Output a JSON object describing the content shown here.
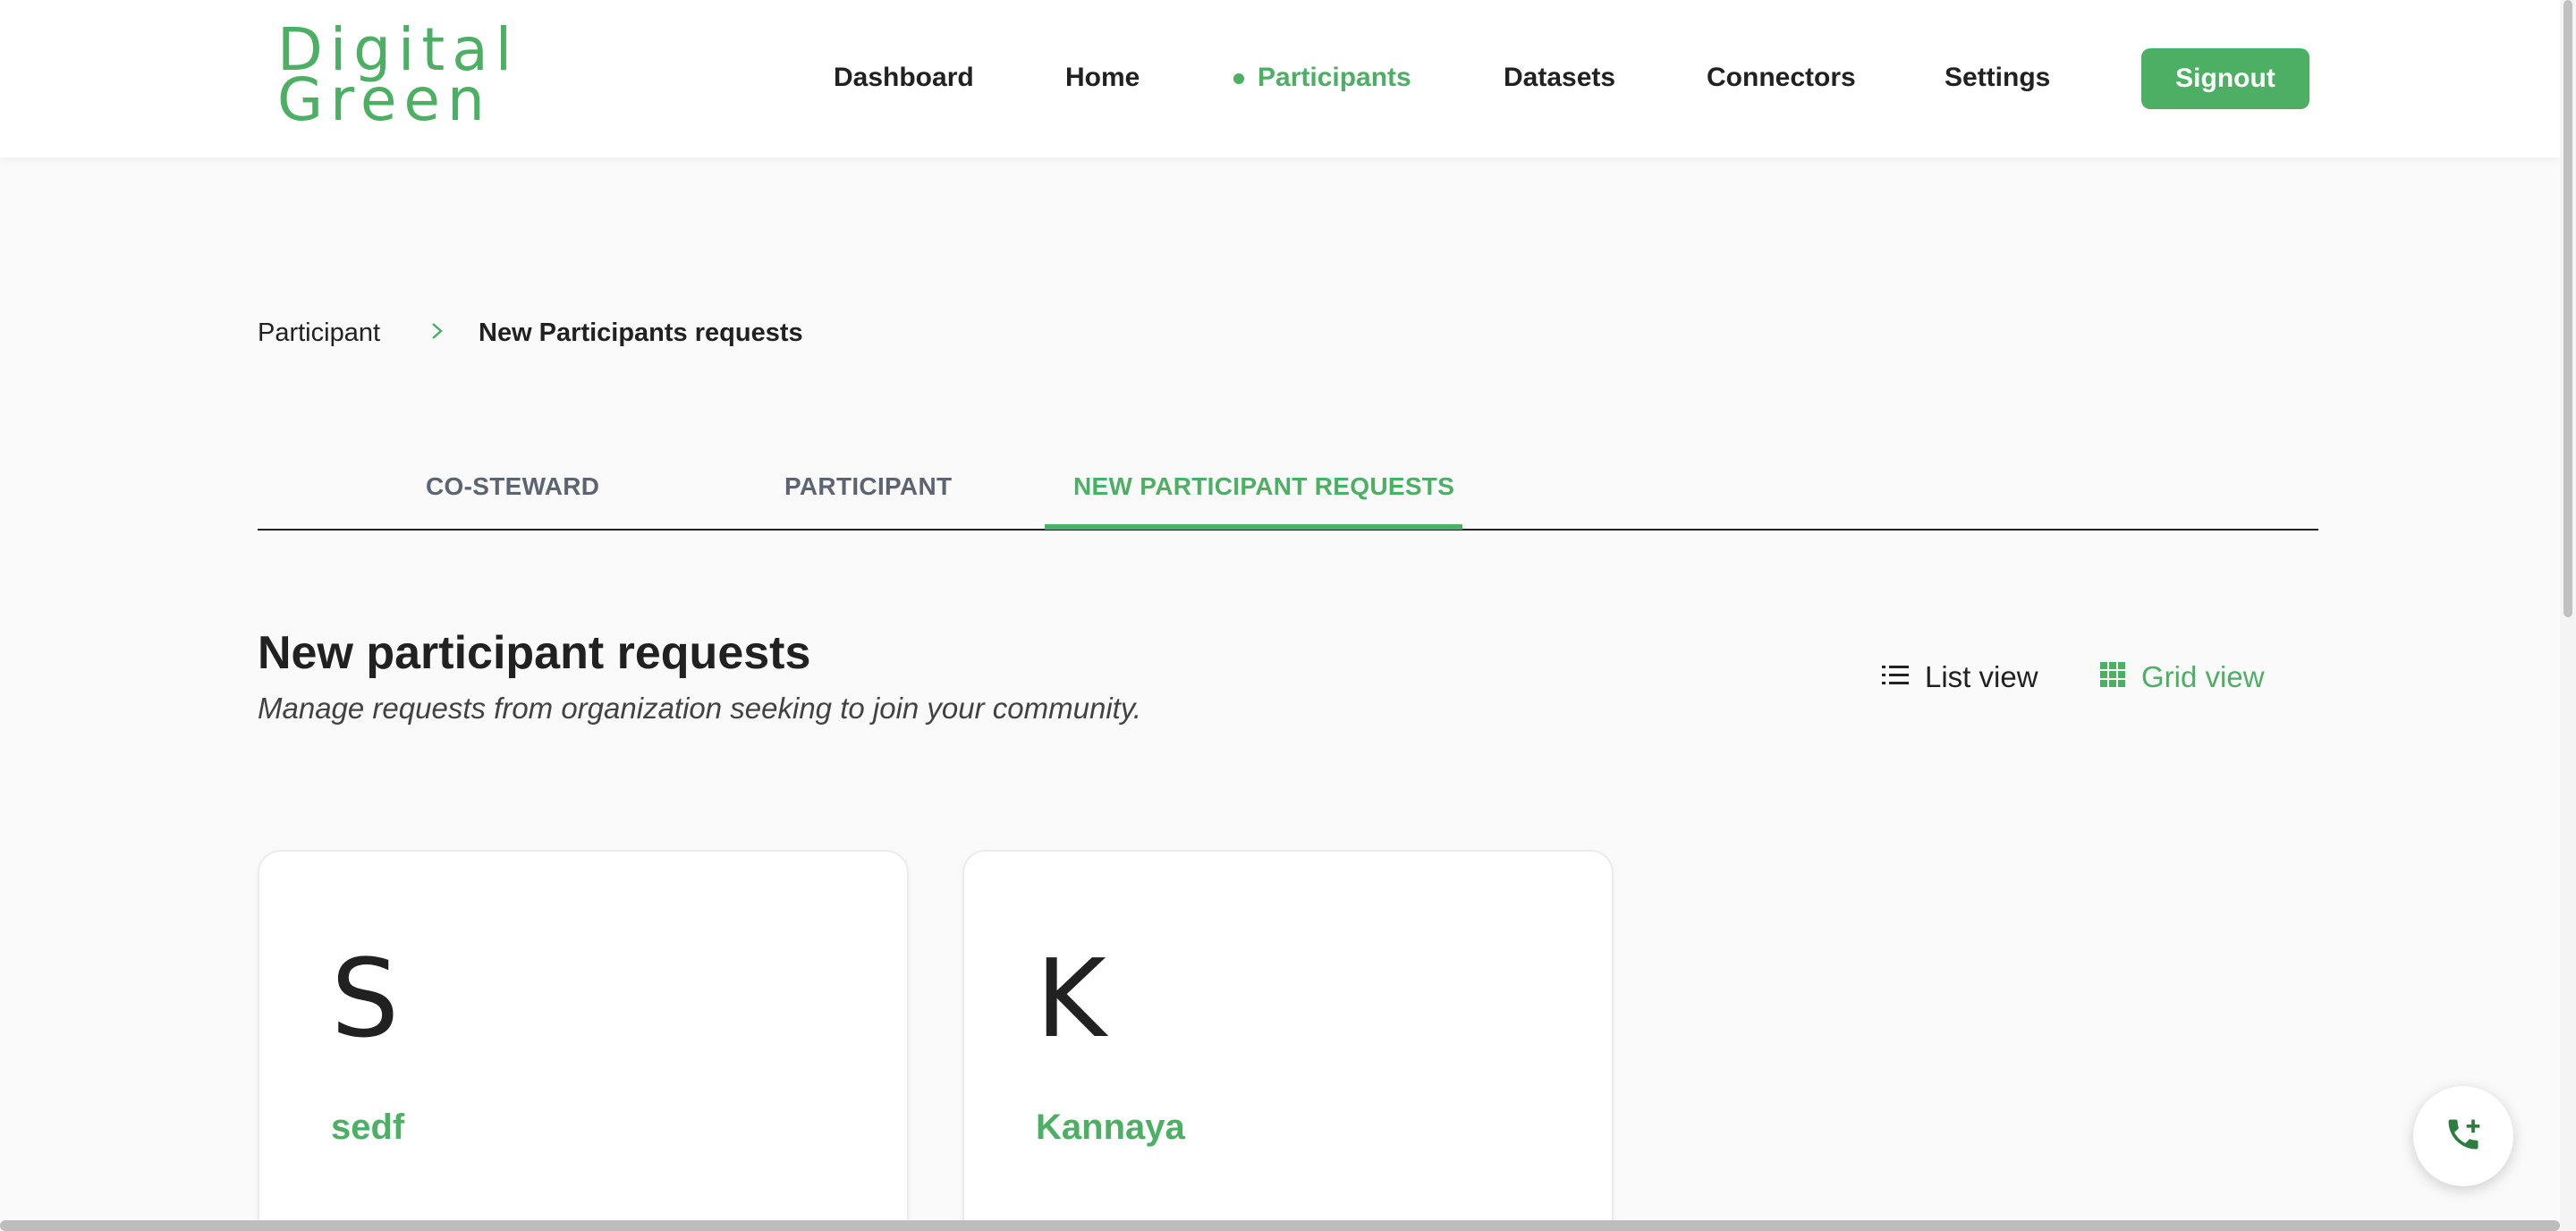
{
  "brand": {
    "line1": "Digital",
    "line2": "Green",
    "accent_color": "#4caf64"
  },
  "nav": {
    "items": [
      {
        "label": "Dashboard"
      },
      {
        "label": "Home"
      },
      {
        "label": "Participants",
        "active": true
      },
      {
        "label": "Datasets"
      },
      {
        "label": "Connectors"
      },
      {
        "label": "Settings"
      }
    ],
    "signout_label": "Signout"
  },
  "breadcrumb": {
    "parent": "Participant",
    "separator": "›",
    "current": "New Participants requests"
  },
  "tabs": [
    {
      "label": "CO-STEWARD"
    },
    {
      "label": "PARTICIPANT"
    },
    {
      "label": "NEW PARTICIPANT REQUESTS",
      "active": true
    }
  ],
  "page": {
    "title": "New participant requests",
    "subtitle": "Manage requests from organization seeking to join your community.",
    "list_view_label": "List view",
    "grid_view_label": "Grid view",
    "active_view": "grid"
  },
  "requests": [
    {
      "initial": "S",
      "name": "sedf"
    },
    {
      "initial": "K",
      "name": "Kannaya"
    }
  ],
  "icons": {
    "breadcrumb_separator": "chevron-right-icon",
    "list_view": "list-icon",
    "grid_view": "grid-icon",
    "support": "phone-add-icon"
  }
}
